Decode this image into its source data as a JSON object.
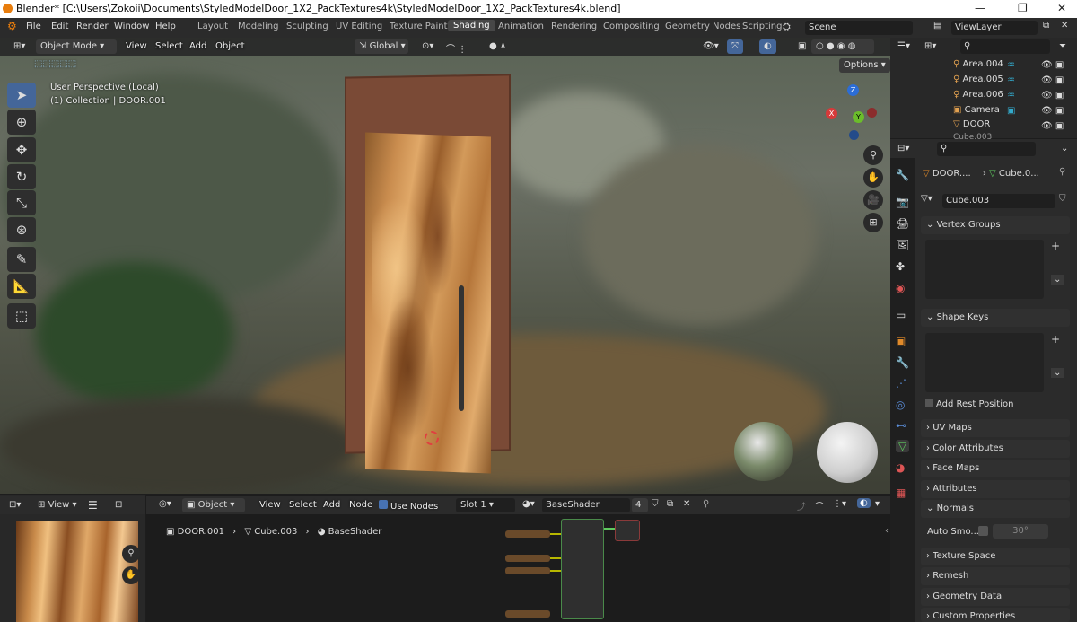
{
  "window": {
    "title": "Blender* [C:\\Users\\Zokoii\\Documents\\StyledModelDoor_1X2_PackTextures4k\\StyledModelDoor_1X2_PackTextures4k.blend]"
  },
  "menu": [
    "File",
    "Edit",
    "Render",
    "Window",
    "Help"
  ],
  "workspaces": [
    "Layout",
    "Modeling",
    "Sculpting",
    "UV Editing",
    "Texture Paint",
    "Shading",
    "Animation",
    "Rendering",
    "Compositing",
    "Geometry Nodes",
    "Scripting"
  ],
  "active_workspace": "Shading",
  "scene": "Scene",
  "view_layer": "ViewLayer",
  "viewport": {
    "mode": "Object Mode",
    "menus": [
      "View",
      "Select",
      "Add",
      "Object"
    ],
    "orientation": "Global",
    "options_label": "Options",
    "overlay_line1": "User Perspective (Local)",
    "overlay_line2": "(1) Collection | DOOR.001",
    "gizmo_axes": {
      "x": "X",
      "y": "Y",
      "z": "Z"
    }
  },
  "outliner": {
    "items": [
      "Area.004",
      "Area.005",
      "Area.006",
      "Camera",
      "DOOR",
      "Cube.003"
    ]
  },
  "properties": {
    "breadcrumb_obj": "DOOR....",
    "breadcrumb_mesh": "Cube.0...",
    "mesh_name": "Cube.003",
    "sections": {
      "vertex_groups": "Vertex Groups",
      "shape_keys": "Shape Keys",
      "add_rest": "Add Rest Position",
      "uv_maps": "UV Maps",
      "color_attributes": "Color Attributes",
      "face_maps": "Face Maps",
      "attributes": "Attributes",
      "normals": "Normals",
      "auto_smooth": "Auto Smo...",
      "auto_smooth_angle": "30°",
      "texture_space": "Texture Space",
      "remesh": "Remesh",
      "geometry_data": "Geometry Data",
      "custom_properties": "Custom Properties"
    }
  },
  "image_editor": {
    "view": "View"
  },
  "node_editor": {
    "type": "Object",
    "menus": [
      "View",
      "Select",
      "Add",
      "Node"
    ],
    "use_nodes": "Use Nodes",
    "slot": "Slot 1",
    "material": "BaseShader",
    "users": "4",
    "breadcrumb": [
      "DOOR.001",
      "Cube.003",
      "BaseShader"
    ]
  }
}
